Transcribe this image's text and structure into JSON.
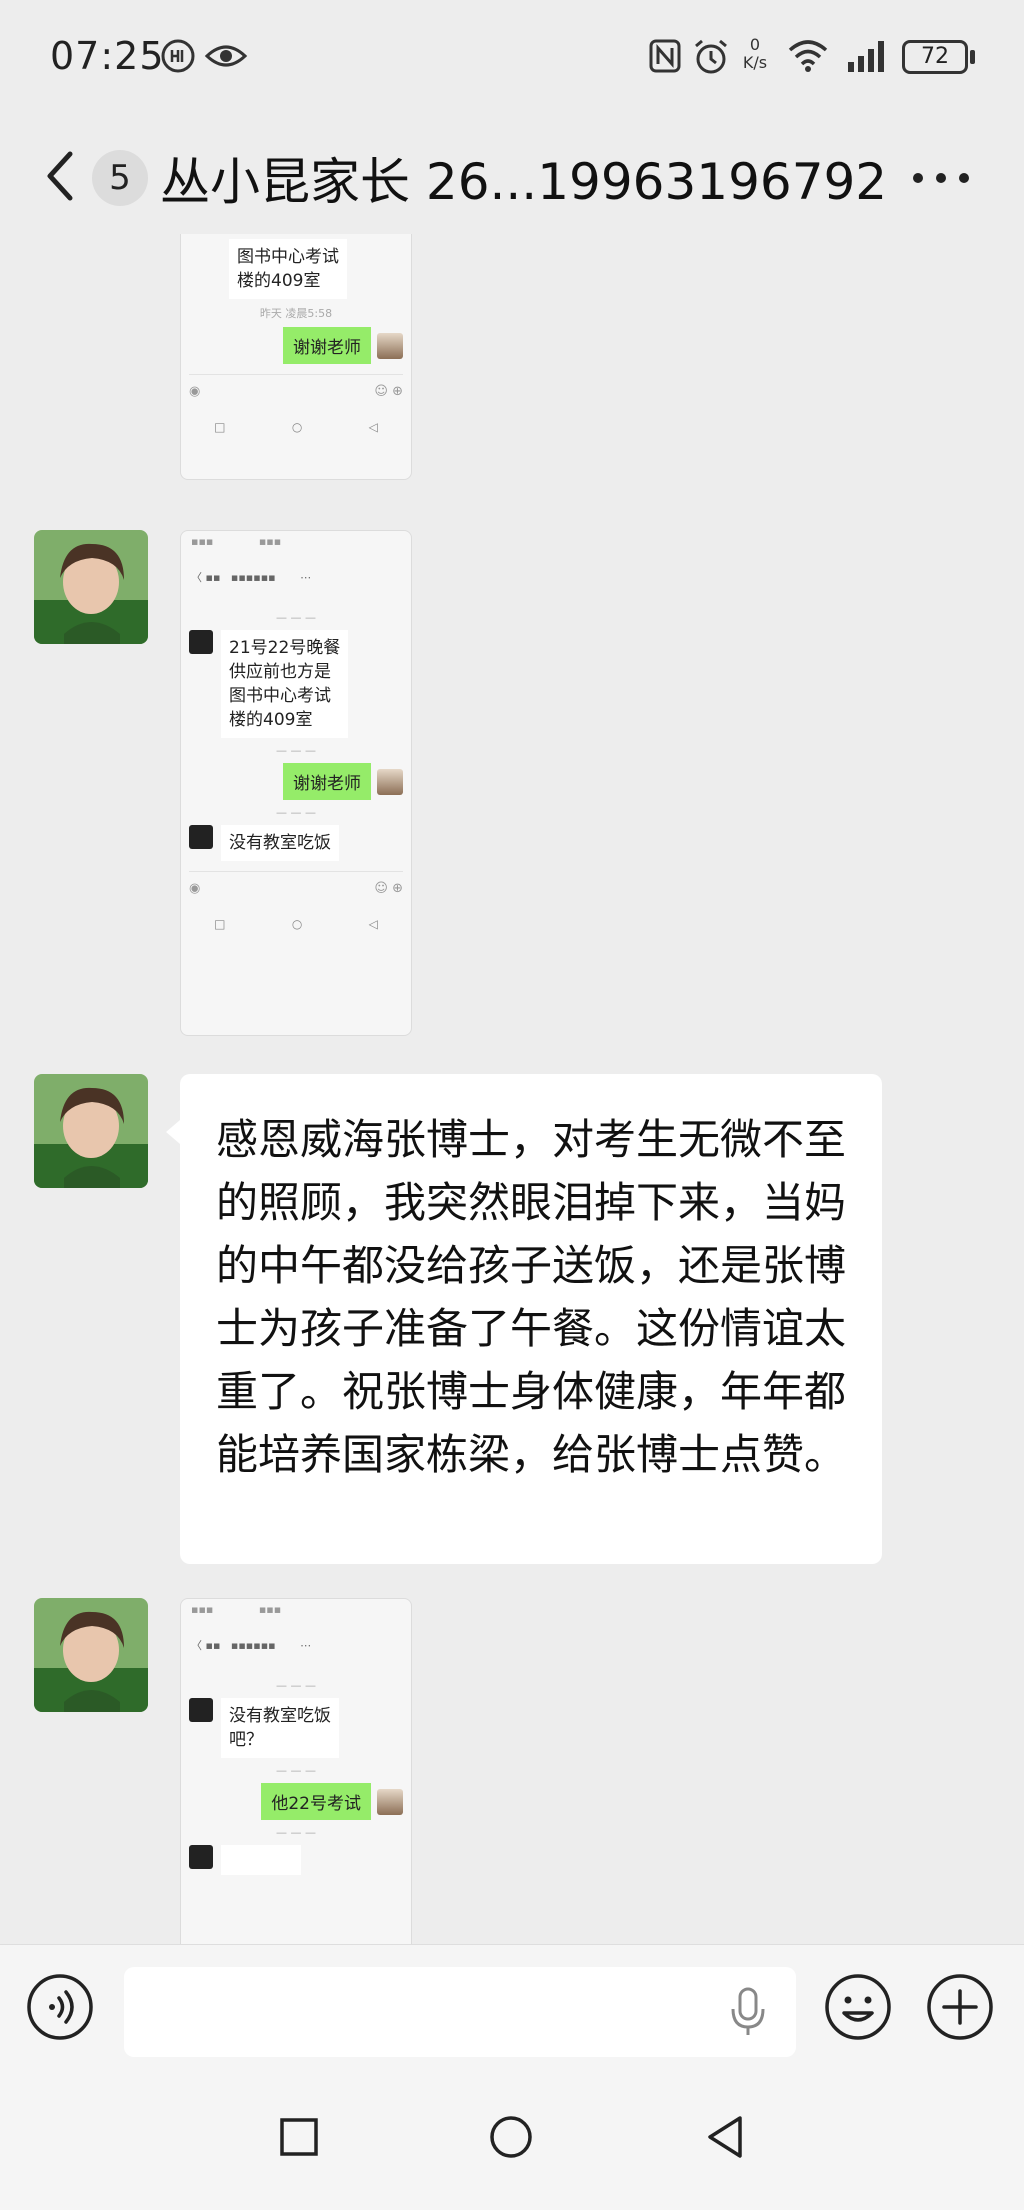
{
  "status_bar": {
    "time": "07:25",
    "battery": "72",
    "net_speed_value": "0",
    "net_speed_unit": "K/s"
  },
  "header": {
    "unread_count": "5",
    "title": "丛小昆家长  26...19963196792"
  },
  "messages": {
    "thumb1": {
      "line1": "图书中心考试",
      "line2": "楼的409室",
      "time": "昨天 凌晨5:58",
      "reply": "谢谢老师"
    },
    "thumb2": {
      "msg": "21号22号晚餐\n供应前也方是\n图书中心考试\n楼的409室",
      "reply": "谢谢老师",
      "msg2": "没有教室吃饭"
    },
    "text_message": "感恩威海张博士，对考生无微不至的照顾，我突然眼泪掉下来，当妈的中午都没给孩子送饭，还是张博士为孩子准备了午餐。这份情谊太重了。祝张博士身体健康，年年都能培养国家栋梁，给张博士点赞。",
    "thumb3": {
      "msg": "没有教室吃饭\n吧？",
      "reply": "他22号考试"
    }
  },
  "colors": {
    "background": "#ededed",
    "bubble_white": "#ffffff",
    "bubble_green": "#95ec69"
  },
  "icons": [
    "back-icon",
    "more-icon",
    "voice-icon",
    "mic-icon",
    "emoji-icon",
    "plus-icon",
    "nav-square-icon",
    "nav-circle-icon",
    "nav-back-icon"
  ]
}
